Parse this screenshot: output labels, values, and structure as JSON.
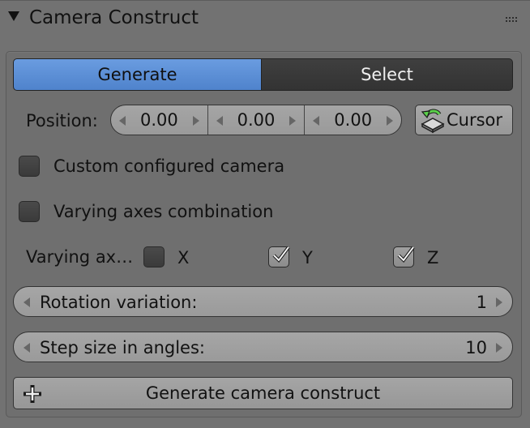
{
  "panel": {
    "title": "Camera Construct"
  },
  "tabs": [
    {
      "label": "Generate",
      "active": true
    },
    {
      "label": "Select",
      "active": false
    }
  ],
  "position": {
    "label": "Position:",
    "values": [
      "0.00",
      "0.00",
      "0.00"
    ],
    "cursor_button": "Cursor"
  },
  "options": {
    "custom_camera": {
      "label": "Custom configured camera",
      "checked": false
    },
    "varying_axes": {
      "label": "Varying axes combination",
      "checked": false
    }
  },
  "axes": {
    "label": "Varying ax…",
    "x": {
      "label": "X",
      "checked": false
    },
    "y": {
      "label": "Y",
      "checked": true
    },
    "z": {
      "label": "Z",
      "checked": true
    }
  },
  "rotation_variation": {
    "label": "Rotation variation:",
    "value": "1"
  },
  "step_size": {
    "label": "Step size in angles:",
    "value": "10"
  },
  "generate_button": {
    "label": "Generate camera construct"
  },
  "icons": {
    "collapse": "triangle-down-icon",
    "grip": "drag-grip-icon",
    "cursor": "cursor-reset-icon",
    "plus": "plus-icon"
  },
  "colors": {
    "panel_bg": "#727272",
    "active_tab": "#5b8fd6",
    "inactive_tab": "#383838",
    "widget_bg": "#a0a0a0"
  }
}
